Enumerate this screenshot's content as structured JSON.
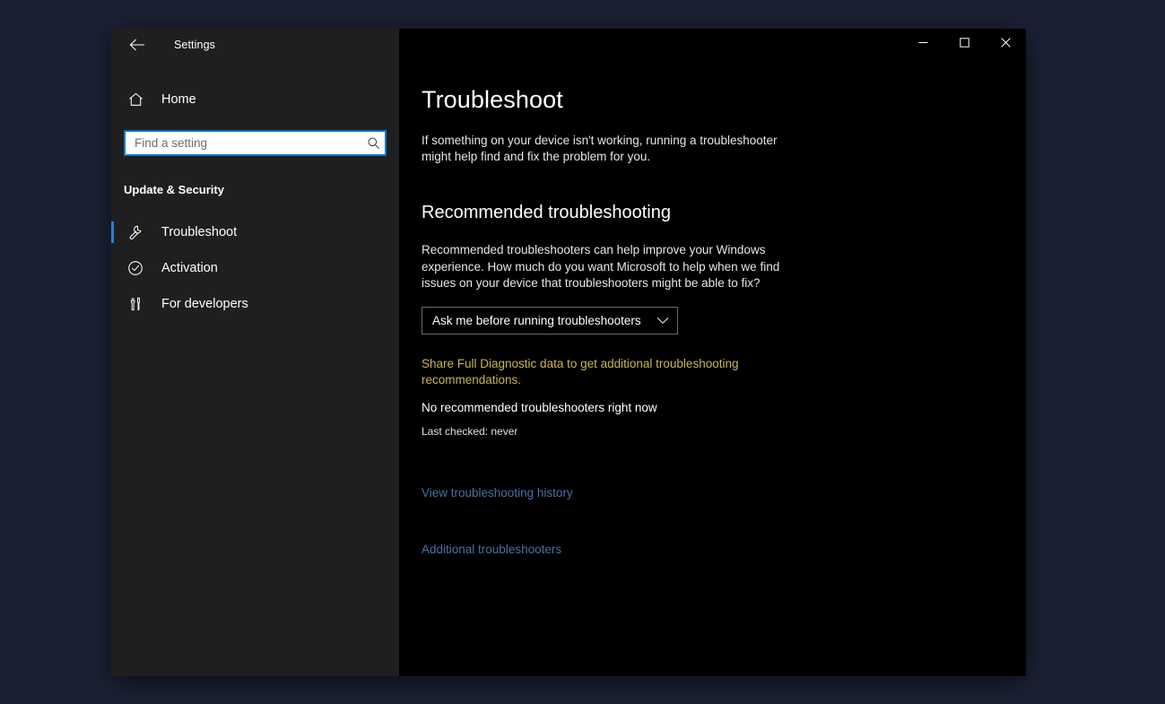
{
  "window": {
    "app_title": "Settings",
    "back_icon": "back-arrow-icon",
    "controls": {
      "minimize": "minimize-icon",
      "maximize": "maximize-icon",
      "close": "close-icon"
    }
  },
  "sidebar": {
    "home": {
      "label": "Home",
      "icon": "home-icon"
    },
    "search": {
      "placeholder": "Find a setting",
      "value": "",
      "icon": "search-icon"
    },
    "group_header": "Update & Security",
    "items": [
      {
        "label": "Troubleshoot",
        "icon": "wrench-icon",
        "selected": true
      },
      {
        "label": "Activation",
        "icon": "check-circle-icon",
        "selected": false
      },
      {
        "label": "For developers",
        "icon": "tools-icon",
        "selected": false
      }
    ]
  },
  "main": {
    "page_title": "Troubleshoot",
    "page_description": "If something on your device isn't working, running a troubleshooter might help find and fix the problem for you.",
    "section_title": "Recommended troubleshooting",
    "section_description": "Recommended troubleshooters can help improve your Windows experience. How much do you want Microsoft to help when we find issues on your device that troubleshooters might be able to fix?",
    "dropdown": {
      "value": "Ask me before running troubleshooters",
      "chevron_icon": "chevron-down-icon"
    },
    "diagnostic_notice": "Share Full Diagnostic data to get additional troubleshooting recommendations.",
    "status": "No recommended troubleshooters right now",
    "last_checked": "Last checked: never",
    "links": {
      "history": "View troubleshooting history",
      "additional": "Additional troubleshooters"
    }
  },
  "colors": {
    "desktop_background": "#1b2133",
    "sidebar_background": "#1f1f1f",
    "content_background": "#000000",
    "accent": "#2a7fd4",
    "search_focus_border": "#0a78c8",
    "link": "#4a6fa5",
    "warning_text": "#c9b458"
  }
}
